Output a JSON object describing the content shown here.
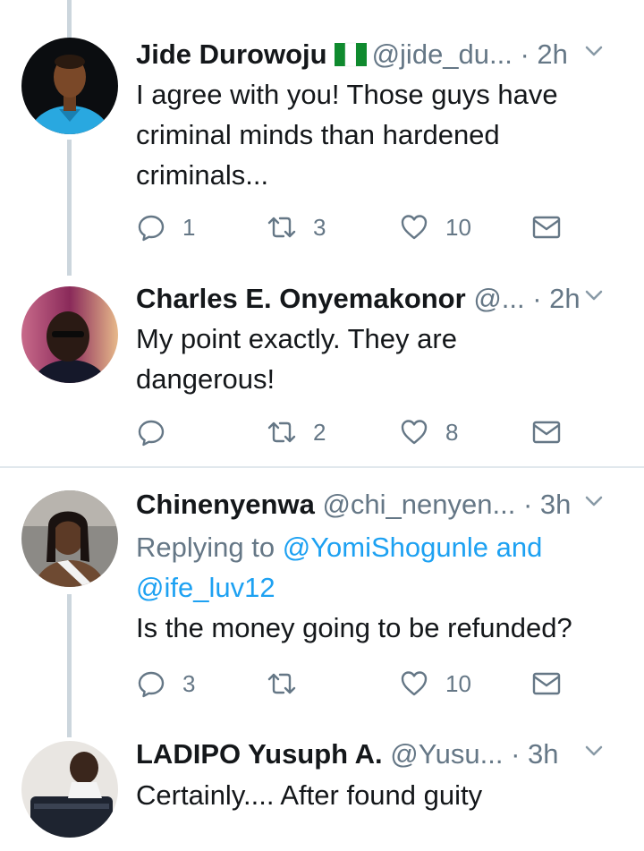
{
  "tweets": [
    {
      "name": "Jide Durowoju",
      "has_flag": true,
      "handle": "@jide_du...",
      "time": "· 2h",
      "text_lines": [
        "I agree with you! Those guys have",
        "criminal minds than hardened",
        "criminals..."
      ],
      "replies": "1",
      "retweets": "3",
      "likes": "10"
    },
    {
      "name": "Charles E. Onyemakonor",
      "handle": "@...",
      "time": "· 2h",
      "text_lines": [
        "My point exactly. They are",
        "dangerous!"
      ],
      "replies": "",
      "retweets": "2",
      "likes": "8"
    },
    {
      "name": "Chinenyenwa",
      "handle": "@chi_nenyen...",
      "time": "· 3h",
      "replying_prefix": "Replying to",
      "replying_user1": "@YomiShogunle",
      "replying_and": "and",
      "replying_user2": "@ife_luv12",
      "text_lines": [
        "Is the money going to be refunded?"
      ],
      "replies": "3",
      "retweets": "",
      "likes": "10"
    },
    {
      "name": "LADIPO Yusuph A.",
      "handle": "@Yusu...",
      "time": "· 3h",
      "text_lines": [
        "Certainly.... After found guity"
      ]
    }
  ],
  "icons": {
    "reply": "reply-icon",
    "retweet": "retweet-icon",
    "like": "heart-icon",
    "dm": "envelope-icon",
    "more": "chevron-down-icon",
    "flag": "nigeria-flag-icon"
  },
  "colors": {
    "text": "#14171a",
    "muted": "#657786",
    "link": "#1da1f2",
    "thread_line": "#ccd6dd",
    "divider": "#e1e8ed"
  }
}
